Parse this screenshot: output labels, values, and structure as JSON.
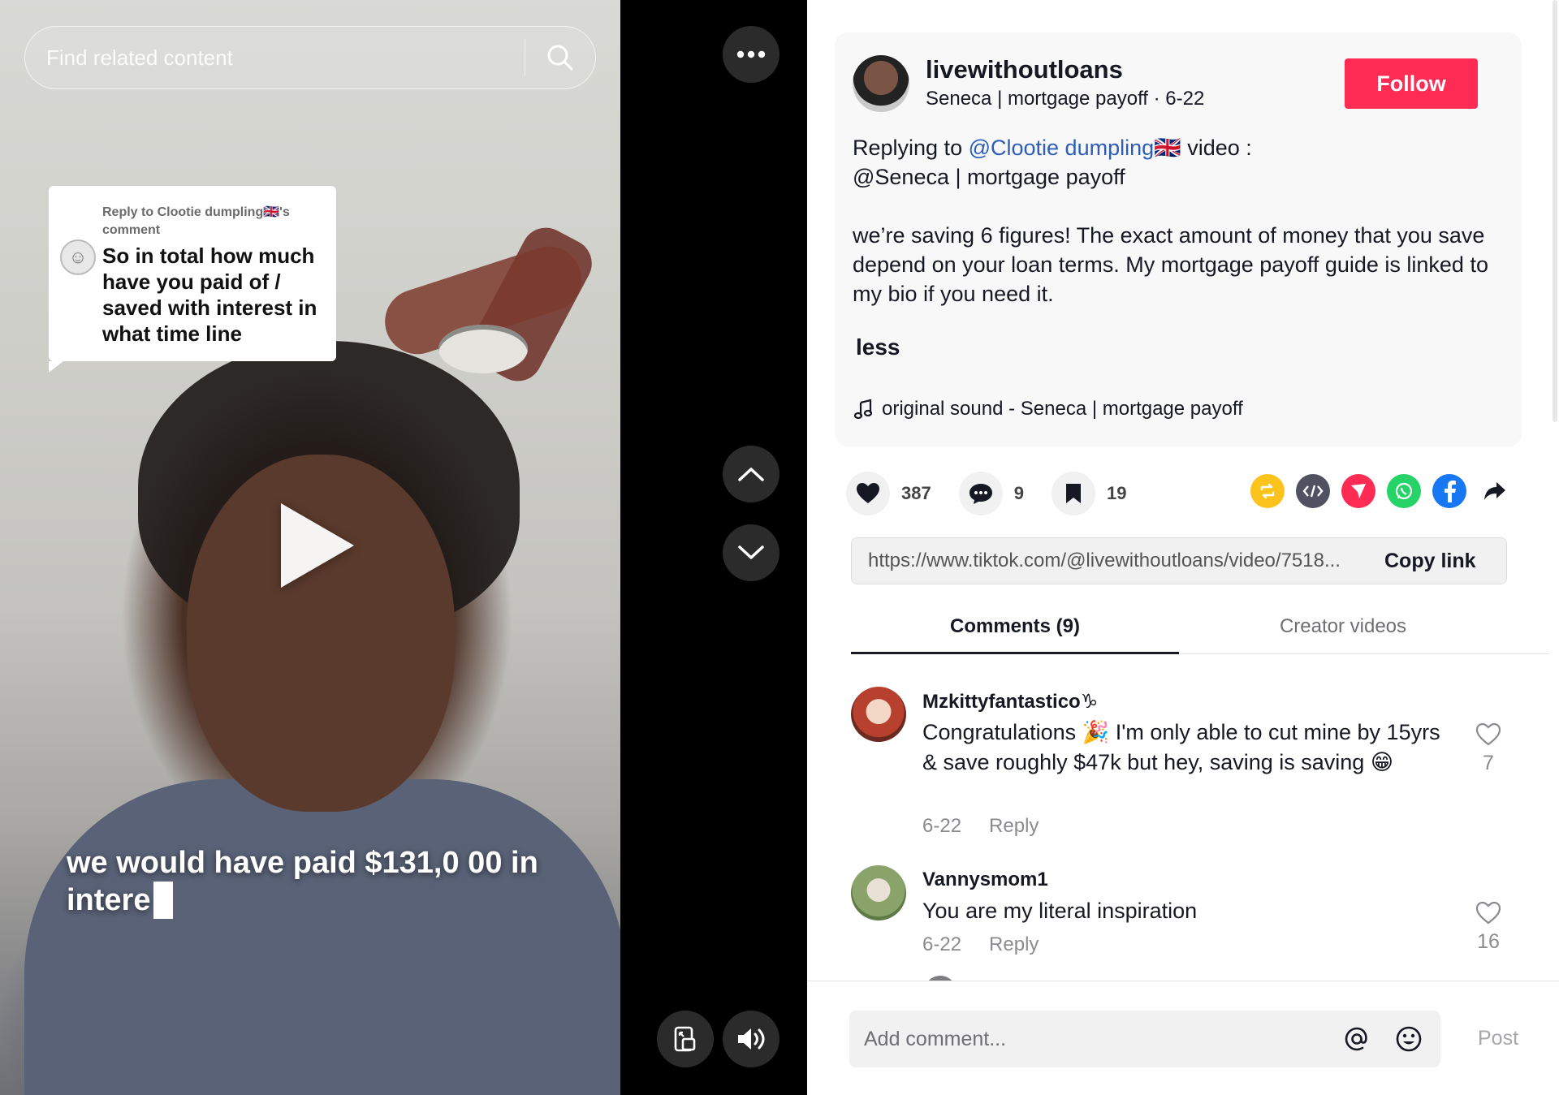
{
  "video": {
    "search_placeholder": "Find related content",
    "reply_bubble": {
      "meta": "Reply to Clootie dumpling🇬🇧's comment",
      "text": "So in total how much have you paid of / saved with interest in what time line"
    },
    "caption": "we would have paid $131,0 00 in intere"
  },
  "post": {
    "author": {
      "username": "livewithoutloans",
      "subtitle": "Seneca | mortgage payoff · 6-22"
    },
    "follow_label": "Follow",
    "description": {
      "reply_prefix": "Replying to ",
      "mention": "@Clootie dumpling🇬🇧",
      "reply_suffix": " video :",
      "line2": "@Seneca | mortgage payoff",
      "body": "we’re saving 6 figures! The exact amount of money that you save depend on your loan terms. My mortgage payoff guide is linked to my bio if you need it."
    },
    "less_label": "less",
    "sound": "original sound - Seneca | mortgage payoff",
    "stats": {
      "likes": "387",
      "comments": "9",
      "saves": "19"
    },
    "share_icons": [
      "repost-icon",
      "embed-icon",
      "send-icon",
      "whatsapp-icon",
      "facebook-icon",
      "share-arrow-icon"
    ],
    "colors": {
      "follow": "#fe2c55",
      "mention": "#2b5db9",
      "repost": "#fcc31c",
      "embed": "#505261",
      "send": "#fe2c55",
      "whatsapp": "#25d366",
      "facebook": "#1877f2"
    },
    "link": {
      "url": "https://www.tiktok.com/@livewithoutloans/video/7518...",
      "copy_label": "Copy link"
    },
    "tabs": [
      {
        "label": "Comments (9)"
      },
      {
        "label": "Creator videos"
      }
    ]
  },
  "comments": [
    {
      "user": "Mzkittyfantastico♑",
      "text": "Congratulations 🎉 I'm only able to cut mine by 15yrs & save roughly $47k but hey, saving is saving 😁",
      "date": "6-22",
      "reply_label": "Reply",
      "likes": "7"
    },
    {
      "user": "Vannysmom1",
      "text": "You are my literal inspiration",
      "date": "6-22",
      "reply_label": "Reply",
      "likes": "16"
    }
  ],
  "composer": {
    "placeholder": "Add comment...",
    "post_label": "Post"
  }
}
